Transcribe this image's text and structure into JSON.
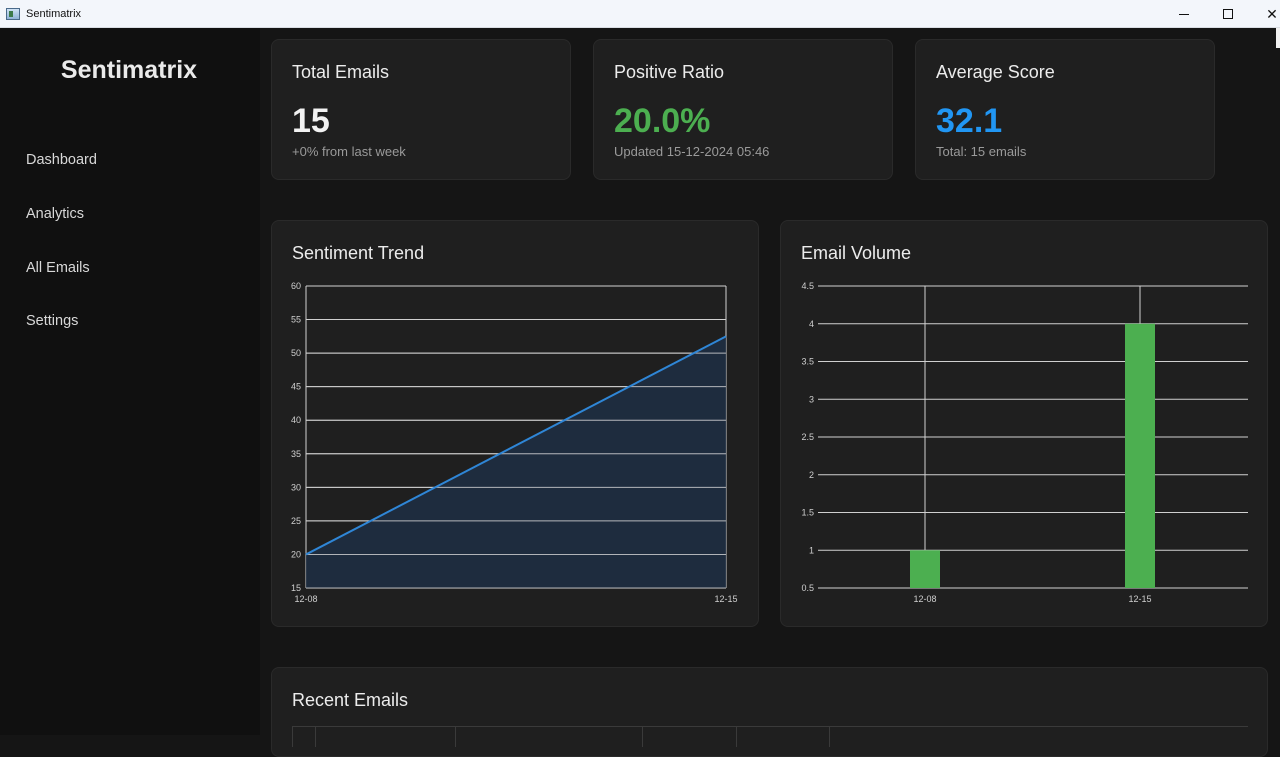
{
  "window": {
    "title": "Sentimatrix"
  },
  "sidebar": {
    "brand": "Sentimatrix",
    "items": [
      {
        "label": "Dashboard"
      },
      {
        "label": "Analytics"
      },
      {
        "label": "All Emails"
      },
      {
        "label": "Settings"
      }
    ]
  },
  "stats": {
    "total_emails": {
      "title": "Total Emails",
      "value": "15",
      "sub": "+0% from last week"
    },
    "positive_ratio": {
      "title": "Positive Ratio",
      "value": "20.0%",
      "sub": "Updated 15-12-2024 05:46",
      "color": "#4caf50"
    },
    "average_score": {
      "title": "Average Score",
      "value": "32.1",
      "sub": "Total: 15 emails",
      "color": "#2196f3"
    }
  },
  "sentiment_panel": {
    "title": "Sentiment Trend"
  },
  "volume_panel": {
    "title": "Email Volume"
  },
  "recent_panel": {
    "title": "Recent Emails"
  },
  "colors": {
    "line": "#2f86d6",
    "area": "#1e2f44",
    "bar": "#4caf50"
  },
  "chart_data": [
    {
      "type": "area",
      "categories": [
        "12-08",
        "12-15"
      ],
      "values": [
        20,
        52.5
      ],
      "ylim": [
        15,
        60
      ],
      "yticks": [
        15,
        20,
        25,
        30,
        35,
        40,
        45,
        50,
        55,
        60
      ],
      "grid": true
    },
    {
      "type": "bar",
      "categories": [
        "12-08",
        "12-15"
      ],
      "values": [
        1,
        4
      ],
      "ylim": [
        0.5,
        4.5
      ],
      "yticks": [
        0.5,
        1,
        1.5,
        2,
        2.5,
        3,
        3.5,
        4,
        4.5
      ],
      "grid": true
    }
  ]
}
